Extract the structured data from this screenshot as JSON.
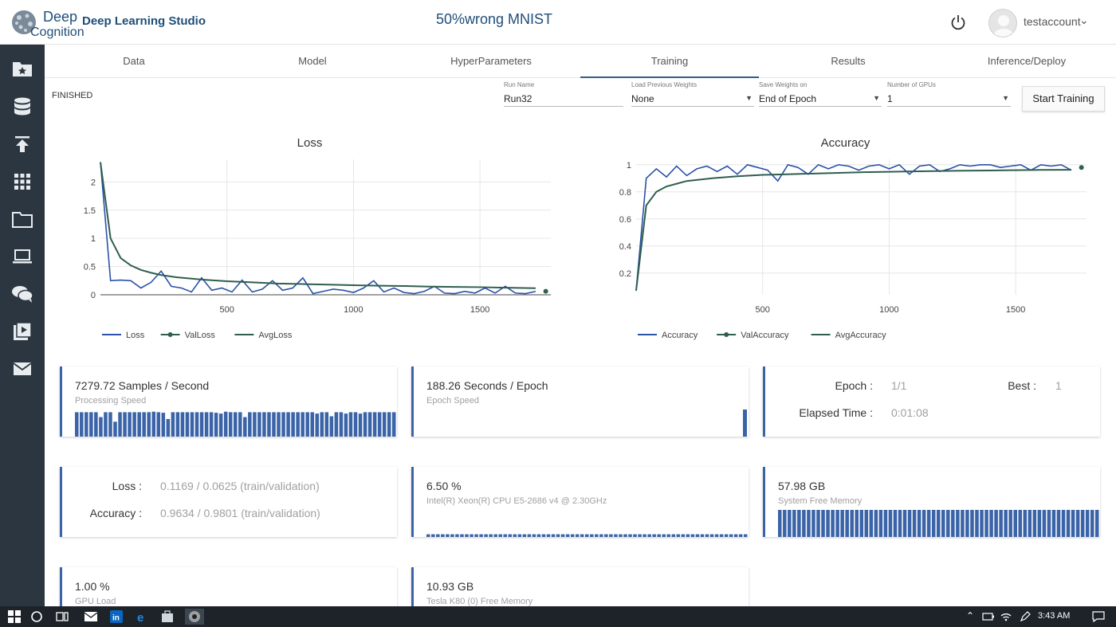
{
  "header": {
    "logo_top": "Deep",
    "logo_bottom": "Cognition",
    "app_title": "Deep Learning Studio",
    "project_title": "50%wrong MNIST",
    "username": "testaccount"
  },
  "sidebar": {
    "icons": [
      "starred-folder-icon",
      "database-icon",
      "upload-icon",
      "apps-grid-icon",
      "folder-icon",
      "laptop-icon",
      "chat-icon",
      "video-icon",
      "mail-icon"
    ]
  },
  "tabs": [
    "Data",
    "Model",
    "HyperParameters",
    "Training",
    "Results",
    "Inference/Deploy"
  ],
  "active_tab": "Training",
  "status": "FINISHED",
  "controls": {
    "run_name": {
      "label": "Run Name",
      "value": "Run32"
    },
    "load_weights": {
      "label": "Load Previous Weights",
      "value": "None"
    },
    "save_weights": {
      "label": "Save Weights on",
      "value": "End of Epoch"
    },
    "gpus": {
      "label": "Number of GPUs",
      "value": "1"
    },
    "start_button": "Start Training"
  },
  "cards": {
    "processing": {
      "value": "7279.72 Samples / Second",
      "label": "Processing Speed"
    },
    "epoch_speed": {
      "value": "188.26 Seconds / Epoch",
      "label": "Epoch Speed"
    },
    "epoch": {
      "epoch_label": "Epoch :",
      "epoch_value": "1/1",
      "best_label": "Best :",
      "best_value": "1",
      "elapsed_label": "Elapsed Time :",
      "elapsed_value": "0:01:08"
    },
    "metrics": {
      "loss_label": "Loss :",
      "loss_value": "0.1169 / 0.0625 (train/validation)",
      "acc_label": "Accuracy :",
      "acc_value": "0.9634 / 0.9801 (train/validation)"
    },
    "cpu": {
      "value": "6.50 %",
      "label": "Intel(R) Xeon(R) CPU E5-2686 v4 @ 2.30GHz"
    },
    "sys_mem": {
      "value": "57.98 GB",
      "label": "System Free Memory"
    },
    "gpu_load": {
      "value": "1.00 %",
      "label": "GPU Load"
    },
    "gpu_mem": {
      "value": "10.93 GB",
      "label": "Tesla K80 (0) Free Memory"
    }
  },
  "taskbar": {
    "time": "3:43 AM"
  },
  "colors": {
    "accent": "#3b64a8",
    "series_blue": "#2a52a8",
    "series_green": "#2f5e4e",
    "sidebar_bg": "#2b3640"
  },
  "chart_data": [
    {
      "type": "line",
      "title": "Loss",
      "xlabel": "",
      "ylabel": "",
      "xlim": [
        0,
        1780
      ],
      "ylim": [
        0,
        2.4
      ],
      "xticks": [
        500,
        1000,
        1500
      ],
      "yticks": [
        0,
        0.5,
        1,
        1.5,
        2
      ],
      "legend_position": "bottom-left",
      "series": [
        {
          "name": "Loss",
          "color": "#2a52a8",
          "x": [
            0,
            40,
            80,
            120,
            160,
            200,
            240,
            280,
            320,
            360,
            400,
            440,
            480,
            520,
            560,
            600,
            640,
            680,
            720,
            760,
            800,
            840,
            880,
            920,
            960,
            1000,
            1040,
            1080,
            1120,
            1160,
            1200,
            1240,
            1280,
            1320,
            1360,
            1400,
            1440,
            1480,
            1520,
            1560,
            1600,
            1640,
            1680,
            1720
          ],
          "y": [
            2.35,
            0.25,
            0.26,
            0.25,
            0.12,
            0.22,
            0.42,
            0.15,
            0.12,
            0.05,
            0.3,
            0.08,
            0.12,
            0.05,
            0.26,
            0.05,
            0.1,
            0.25,
            0.08,
            0.12,
            0.3,
            0.02,
            0.06,
            0.1,
            0.08,
            0.04,
            0.12,
            0.25,
            0.05,
            0.12,
            0.04,
            0.02,
            0.06,
            0.15,
            0.03,
            0.02,
            0.06,
            0.03,
            0.12,
            0.03,
            0.15,
            0.03,
            0.02,
            0.06
          ]
        },
        {
          "name": "ValLoss",
          "color": "#2f5e4e",
          "marker": "circle",
          "x": [
            1760
          ],
          "y": [
            0.0625
          ]
        },
        {
          "name": "AvgLoss",
          "color": "#2f5e4e",
          "x": [
            0,
            40,
            80,
            120,
            160,
            200,
            240,
            300,
            400,
            500,
            600,
            700,
            800,
            900,
            1000,
            1100,
            1200,
            1300,
            1400,
            1500,
            1600,
            1720
          ],
          "y": [
            2.35,
            1.0,
            0.65,
            0.52,
            0.44,
            0.39,
            0.35,
            0.31,
            0.27,
            0.24,
            0.22,
            0.2,
            0.19,
            0.18,
            0.17,
            0.16,
            0.155,
            0.145,
            0.14,
            0.135,
            0.125,
            0.117
          ]
        }
      ]
    },
    {
      "type": "line",
      "title": "Accuracy",
      "xlabel": "",
      "ylabel": "",
      "xlim": [
        0,
        1780
      ],
      "ylim": [
        0.04,
        1.04
      ],
      "xticks": [
        500,
        1000,
        1500
      ],
      "yticks": [
        0.2,
        0.4,
        0.6,
        0.8,
        1
      ],
      "legend_position": "bottom-left",
      "series": [
        {
          "name": "Accuracy",
          "color": "#2a52a8",
          "x": [
            0,
            40,
            80,
            120,
            160,
            200,
            240,
            280,
            320,
            360,
            400,
            440,
            480,
            520,
            560,
            600,
            640,
            680,
            720,
            760,
            800,
            840,
            880,
            920,
            960,
            1000,
            1040,
            1080,
            1120,
            1160,
            1200,
            1240,
            1280,
            1320,
            1360,
            1400,
            1440,
            1480,
            1520,
            1560,
            1600,
            1640,
            1680,
            1720
          ],
          "y": [
            0.07,
            0.9,
            0.97,
            0.91,
            0.99,
            0.92,
            0.97,
            0.99,
            0.95,
            0.99,
            0.93,
            1.0,
            0.98,
            0.96,
            0.88,
            1.0,
            0.98,
            0.93,
            1.0,
            0.97,
            1.0,
            0.99,
            0.96,
            0.99,
            1.0,
            0.97,
            1.0,
            0.93,
            0.99,
            1.0,
            0.95,
            0.97,
            1.0,
            0.99,
            1.0,
            1.0,
            0.98,
            0.99,
            1.0,
            0.96,
            1.0,
            0.99,
            1.0,
            0.96
          ]
        },
        {
          "name": "ValAccuracy",
          "color": "#2f5e4e",
          "marker": "circle",
          "x": [
            1760
          ],
          "y": [
            0.98
          ]
        },
        {
          "name": "AvgAccuracy",
          "color": "#2f5e4e",
          "x": [
            0,
            40,
            80,
            120,
            160,
            200,
            300,
            400,
            500,
            600,
            700,
            800,
            900,
            1000,
            1100,
            1200,
            1300,
            1400,
            1500,
            1600,
            1720
          ],
          "y": [
            0.07,
            0.7,
            0.8,
            0.84,
            0.86,
            0.88,
            0.9,
            0.915,
            0.925,
            0.93,
            0.935,
            0.94,
            0.945,
            0.948,
            0.951,
            0.954,
            0.956,
            0.958,
            0.96,
            0.962,
            0.963
          ]
        }
      ]
    }
  ],
  "mini_bars": {
    "processing": [
      0.9,
      0.9,
      0.9,
      0.9,
      0.9,
      0.72,
      0.9,
      0.9,
      0.55,
      0.9,
      0.9,
      0.9,
      0.9,
      0.9,
      0.9,
      0.9,
      0.92,
      0.9,
      0.88,
      0.65,
      0.9,
      0.9,
      0.9,
      0.9,
      0.9,
      0.9,
      0.9,
      0.9,
      0.9,
      0.88,
      0.85,
      0.92,
      0.9,
      0.9,
      0.9,
      0.72,
      0.9,
      0.9,
      0.9,
      0.9,
      0.9,
      0.9,
      0.9,
      0.9,
      0.9,
      0.9,
      0.9,
      0.9,
      0.9,
      0.9,
      0.85,
      0.9,
      0.9,
      0.75,
      0.9,
      0.9,
      0.85,
      0.9,
      0.9,
      0.85,
      0.9,
      0.9,
      0.9,
      0.9,
      0.9,
      0.9,
      0.9
    ],
    "epoch": [
      1.0
    ],
    "cpu": [
      0.1,
      0.1,
      0.1,
      0.1,
      0.1,
      0.1,
      0.1,
      0.1,
      0.1,
      0.1,
      0.1,
      0.1,
      0.1,
      0.1,
      0.1,
      0.1,
      0.1,
      0.1,
      0.1,
      0.1,
      0.1,
      0.1,
      0.1,
      0.1,
      0.1,
      0.1,
      0.1,
      0.1,
      0.1,
      0.1,
      0.1,
      0.1,
      0.1,
      0.1,
      0.1,
      0.1,
      0.1,
      0.1,
      0.1,
      0.1,
      0.1,
      0.1,
      0.1,
      0.1,
      0.1,
      0.1,
      0.1,
      0.1,
      0.1,
      0.1,
      0.1,
      0.1,
      0.1,
      0.1,
      0.1,
      0.1,
      0.1,
      0.1,
      0.1,
      0.1,
      0.1,
      0.1,
      0.1,
      0.1,
      0.1,
      0.1,
      0.1
    ],
    "sys_mem": [
      1,
      1,
      1,
      1,
      1,
      1,
      1,
      1,
      1,
      1,
      1,
      1,
      1,
      1,
      1,
      1,
      1,
      1,
      1,
      1,
      1,
      1,
      1,
      1,
      1,
      1,
      1,
      1,
      1,
      1,
      1,
      1,
      1,
      1,
      1,
      1,
      1,
      1,
      1,
      1,
      1,
      1,
      1,
      1,
      1,
      1,
      1,
      1,
      1,
      1,
      1,
      1,
      1,
      1,
      1,
      1,
      1,
      1,
      1,
      1,
      1,
      1,
      1,
      1,
      1,
      1,
      1
    ]
  }
}
